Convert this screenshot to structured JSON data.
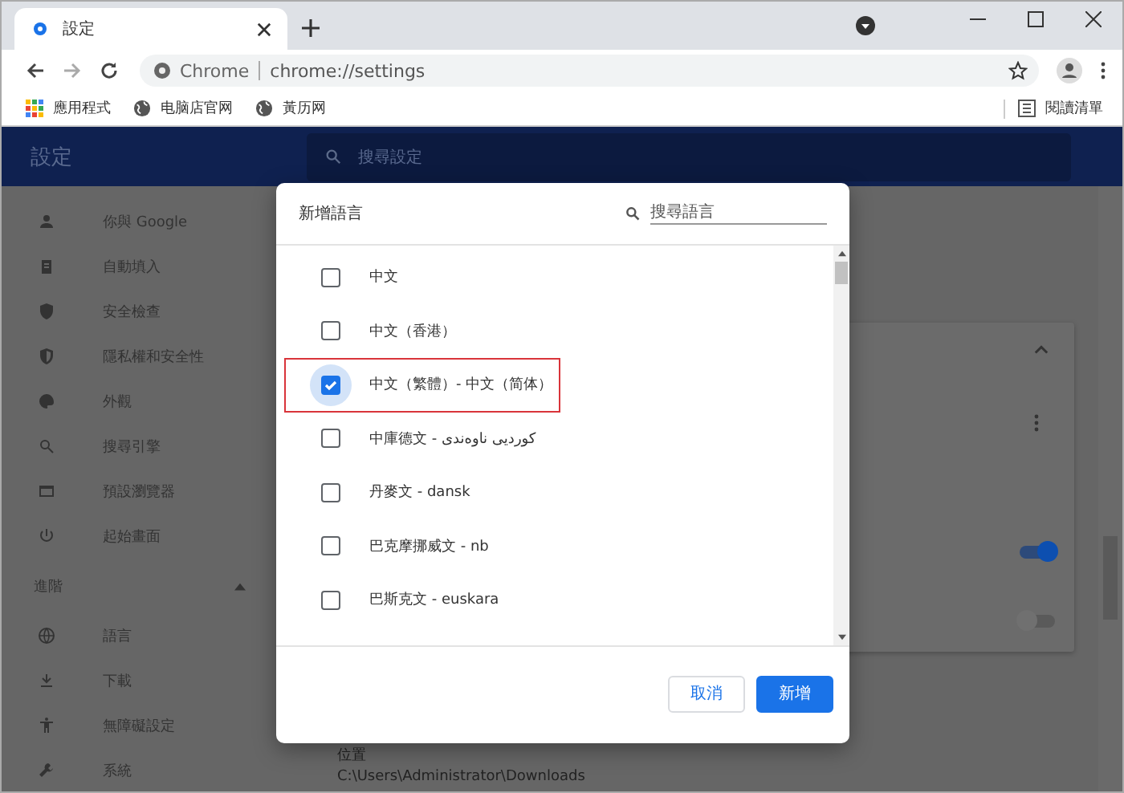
{
  "browser": {
    "tab": {
      "title": "設定"
    },
    "address": {
      "origin": "Chrome",
      "url": "chrome://settings"
    },
    "bookmarks": [
      {
        "kind": "apps",
        "label": "應用程式"
      },
      {
        "kind": "globe",
        "label": "电脑店官网"
      },
      {
        "kind": "globe",
        "label": "黃历网"
      }
    ],
    "reading_list": "閱讀清單"
  },
  "settings_header": {
    "title": "設定",
    "search_placeholder": "搜尋設定"
  },
  "sidebar": {
    "items": [
      {
        "label": "你與 Google"
      },
      {
        "label": "自動填入"
      },
      {
        "label": "安全檢查"
      },
      {
        "label": "隱私權和安全性"
      },
      {
        "label": "外觀"
      },
      {
        "label": "搜尋引擎"
      },
      {
        "label": "預設瀏覽器"
      },
      {
        "label": "起始畫面"
      }
    ],
    "section": {
      "label": "進階",
      "expanded": true
    },
    "advanced_items": [
      {
        "label": "語言"
      },
      {
        "label": "下載"
      },
      {
        "label": "無障礙設定"
      },
      {
        "label": "系統"
      }
    ]
  },
  "content": {
    "toggles": [
      {
        "on": true
      },
      {
        "on": false
      }
    ],
    "download_location": {
      "label": "位置",
      "path": "C:\\Users\\Administrator\\Downloads"
    }
  },
  "dialog": {
    "title": "新增語言",
    "search_placeholder": "搜尋語言",
    "languages": [
      {
        "label": "中文",
        "checked": false,
        "highlighted": false
      },
      {
        "label": "中文（香港）",
        "checked": false,
        "highlighted": false
      },
      {
        "label": "中文（繁體）- 中文（简体）",
        "checked": true,
        "highlighted": true
      },
      {
        "label": "中庫德文 - کوردیی ناوەندی",
        "checked": false,
        "highlighted": false
      },
      {
        "label": "丹麥文 - dansk",
        "checked": false,
        "highlighted": false
      },
      {
        "label": "巴克摩挪威文 - nb",
        "checked": false,
        "highlighted": false
      },
      {
        "label": "巴斯克文 - euskara",
        "checked": false,
        "highlighted": false
      }
    ],
    "buttons": [
      {
        "kind": "secondary",
        "label": "取消"
      },
      {
        "kind": "primary",
        "label": "新增"
      }
    ]
  }
}
